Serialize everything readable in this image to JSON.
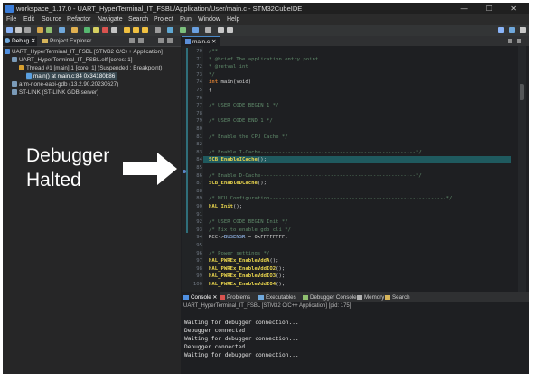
{
  "window": {
    "title": "workspace_1.17.0 - UART_HyperTerminal_IT_FSBL/Application/User/main.c - STM32CubeIDE",
    "controls": "— ❐ ✕"
  },
  "menu": [
    "File",
    "Edit",
    "Source",
    "Refactor",
    "Navigate",
    "Search",
    "Project",
    "Run",
    "Window",
    "Help"
  ],
  "debug_view": {
    "tabs": [
      "Debug",
      "Project Explorer"
    ],
    "tree": [
      {
        "label": "UART_HyperTerminal_IT_FSBL [STM32 C/C++ Application]",
        "icon_color": "#4f8fe0"
      },
      {
        "label": "UART_HyperTerminal_IT_FSBL.elf [cores: 1]",
        "icon_color": "#7a9ab8"
      },
      {
        "label": "Thread #1 [main] 1 [core: 1] (Suspended : Breakpoint)",
        "icon_color": "#d8a030"
      },
      {
        "label": "main() at main.c:84 0x34180b86",
        "icon_color": "#5aa0e0"
      },
      {
        "label": "arm-none-eabi-gdb (13.2.90.20230627)",
        "icon_color": "#7a9ab8"
      },
      {
        "label": "ST-LINK (ST-LINK GDB server)",
        "icon_color": "#7a9ab8"
      }
    ]
  },
  "editor": {
    "tab": "main.c ✕",
    "lines": [
      {
        "no": "70",
        "parts": [
          {
            "t": "/**",
            "c": "comment"
          }
        ]
      },
      {
        "no": "71",
        "parts": [
          {
            "t": "  * @brief  The application entry point.",
            "c": "comment"
          }
        ]
      },
      {
        "no": "72",
        "parts": [
          {
            "t": "  * @retval int",
            "c": "comment"
          }
        ]
      },
      {
        "no": "73",
        "parts": [
          {
            "t": "  */",
            "c": "comment"
          }
        ]
      },
      {
        "no": "74",
        "parts": [
          {
            "t": "int ",
            "c": "kw"
          },
          {
            "t": "main(void)",
            "c": "norm"
          }
        ]
      },
      {
        "no": "75",
        "parts": [
          {
            "t": "{",
            "c": "norm"
          }
        ]
      },
      {
        "no": "76",
        "parts": []
      },
      {
        "no": "77",
        "parts": [
          {
            "t": "  /* USER CODE BEGIN 1 */",
            "c": "comment"
          }
        ]
      },
      {
        "no": "78",
        "parts": []
      },
      {
        "no": "79",
        "parts": [
          {
            "t": "  /* USER CODE END 1 */",
            "c": "comment"
          }
        ]
      },
      {
        "no": "80",
        "parts": []
      },
      {
        "no": "81",
        "parts": [
          {
            "t": "  /* Enable the CPU Cache */",
            "c": "comment"
          }
        ]
      },
      {
        "no": "82",
        "parts": []
      },
      {
        "no": "83",
        "parts": [
          {
            "t": "  /* Enable I-Cache---------------------------------------------------*/",
            "c": "comment"
          }
        ]
      },
      {
        "no": "84",
        "parts": [
          {
            "t": "  SCB_EnableICache",
            "c": "fn"
          },
          {
            "t": "();",
            "c": "norm"
          }
        ],
        "current": true
      },
      {
        "no": "85",
        "parts": []
      },
      {
        "no": "86",
        "parts": [
          {
            "t": "  /* Enable D-Cache---------------------------------------------------*/",
            "c": "comment"
          }
        ]
      },
      {
        "no": "87",
        "parts": [
          {
            "t": "  SCB_EnableDCache",
            "c": "fn"
          },
          {
            "t": "();",
            "c": "norm"
          }
        ]
      },
      {
        "no": "88",
        "parts": []
      },
      {
        "no": "89",
        "parts": [
          {
            "t": "  /* MCU Configuration----------------------------------------------------------*/",
            "c": "comment"
          }
        ]
      },
      {
        "no": "90",
        "parts": [
          {
            "t": "  HAL_Init",
            "c": "fn"
          },
          {
            "t": "();",
            "c": "norm"
          }
        ]
      },
      {
        "no": "91",
        "parts": []
      },
      {
        "no": "92",
        "parts": [
          {
            "t": "  /* USER CODE BEGIN Init */",
            "c": "comment"
          }
        ]
      },
      {
        "no": "93",
        "parts": [
          {
            "t": "  /* Fix to enable gdb cli */",
            "c": "comment"
          }
        ]
      },
      {
        "no": "94",
        "parts": [
          {
            "t": "  RCC->",
            "c": "norm"
          },
          {
            "t": "BUSENSR",
            "c": "var"
          },
          {
            "t": " = 0xFFFFFFFF;",
            "c": "norm"
          }
        ]
      },
      {
        "no": "95",
        "parts": []
      },
      {
        "no": "96",
        "parts": [
          {
            "t": "  /* Power settings */",
            "c": "comment"
          }
        ]
      },
      {
        "no": "97",
        "parts": [
          {
            "t": "  HAL_PWREx_EnableVddA",
            "c": "fn"
          },
          {
            "t": "();",
            "c": "norm"
          }
        ]
      },
      {
        "no": "98",
        "parts": [
          {
            "t": "  HAL_PWREx_EnableVddIO2",
            "c": "fn"
          },
          {
            "t": "();",
            "c": "norm"
          }
        ]
      },
      {
        "no": "99",
        "parts": [
          {
            "t": "  HAL_PWREx_EnableVddIO3",
            "c": "fn"
          },
          {
            "t": "();",
            "c": "norm"
          }
        ]
      },
      {
        "no": "100",
        "parts": [
          {
            "t": "  HAL_PWREx_EnableVddIO4",
            "c": "fn"
          },
          {
            "t": "();",
            "c": "norm"
          }
        ]
      }
    ]
  },
  "console": {
    "tabs": [
      "Console",
      "Problems",
      "Executables",
      "Debugger Console",
      "Memory",
      "Search"
    ],
    "info": "UART_HyperTerminal_IT_FSBL [STM32 C/C++ Application] [pid: 175]",
    "lines": [
      "Waiting for debugger connection...",
      "Debugger connected",
      "Waiting for debugger connection...",
      "Debugger connected",
      "Waiting for debugger connection..."
    ]
  },
  "annotation": {
    "line1": "Debugger",
    "line2": "Halted"
  },
  "colors": {
    "comment": "#5f8a6a",
    "function": "#e8d44d",
    "keyword": "#cc7832",
    "current_line": "#1f5a5f"
  }
}
